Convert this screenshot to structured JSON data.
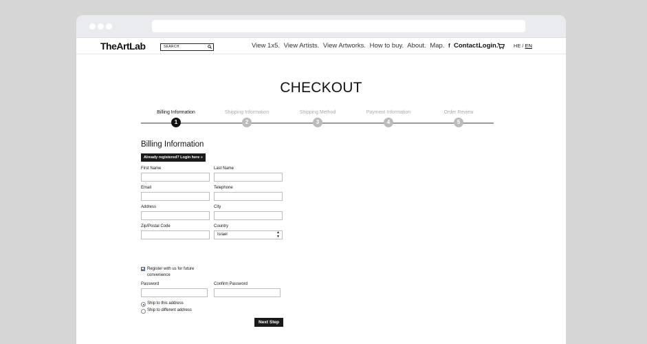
{
  "header": {
    "logo": "TheArtLab",
    "search_placeholder": "SEARCH",
    "nav": [
      "View 1x5.",
      "View Artists.",
      "View Artworks.",
      "How to buy.",
      "About.",
      "Map."
    ],
    "facebook_glyph": "f",
    "contact": "Contact.",
    "login": "Login.",
    "lang_he": "HE",
    "lang_sep": "/",
    "lang_en": "EN"
  },
  "page": {
    "title": "CHECKOUT"
  },
  "steps": [
    {
      "label": "Billing Information",
      "number": "1",
      "active": true
    },
    {
      "label": "Shipping Information",
      "number": "2",
      "active": false
    },
    {
      "label": "Shipping Method",
      "number": "3",
      "active": false
    },
    {
      "label": "Payment Information",
      "number": "4",
      "active": false
    },
    {
      "label": "Order Review",
      "number": "5",
      "active": false
    }
  ],
  "form": {
    "section_title": "Billing Information",
    "login_button": "Already registered? Login here »",
    "first_name": "First Name",
    "last_name": "Last Name",
    "email": "Email",
    "telephone": "Telephone",
    "address": "Address",
    "city": "City",
    "zip": "Zip/Postal Code",
    "country": "Country",
    "country_value": "Israel",
    "register_line1": "Register with us for future",
    "register_line2": "convenience",
    "password": "Password",
    "confirm_password": "Confirm Password",
    "ship_same": "Ship to this address",
    "ship_different": "Ship to different address",
    "next_button": "Next Step"
  }
}
